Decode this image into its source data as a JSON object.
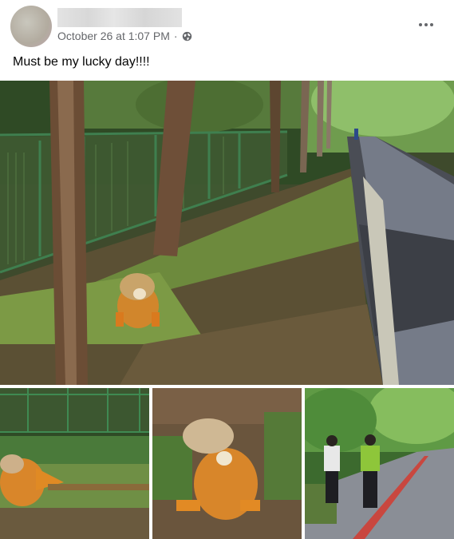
{
  "post": {
    "timestamp": "October 26 at 1:07 PM",
    "separator": "·",
    "audience_icon": "globe-icon",
    "more_icon": "more-options-icon",
    "caption": "Must be my lucky day!!!!"
  },
  "photos": [
    {
      "description_name": "main-photo"
    },
    {
      "description_name": "iguana-fence-photo"
    },
    {
      "description_name": "iguana-closeup-photo"
    },
    {
      "description_name": "joggers-path-photo"
    }
  ]
}
